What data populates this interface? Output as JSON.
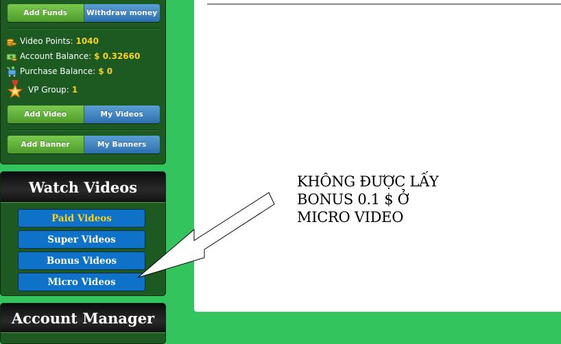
{
  "account_panel": {
    "buttons": [
      {
        "add": "Add Funds",
        "other": "Withdraw money"
      },
      {
        "add": "Add Video",
        "other": "My Videos"
      },
      {
        "add": "Add Banner",
        "other": "My Banners"
      }
    ],
    "stats": {
      "video_points": {
        "label": "Video Points:",
        "value": "1040",
        "icon": "coins-icon"
      },
      "account_balance": {
        "label": "Account Balance:",
        "value": "$ 0.32660",
        "icon": "money-icon"
      },
      "purchase_balance": {
        "label": "Purchase Balance:",
        "value": "$ 0",
        "icon": "cart-icon"
      },
      "vp_group": {
        "label": "VP Group:",
        "value": "1",
        "icon": "star-badge-icon"
      }
    }
  },
  "watch_videos": {
    "title": "Watch Videos",
    "items": [
      {
        "label": "Paid Videos",
        "active": true
      },
      {
        "label": "Super Videos",
        "active": false
      },
      {
        "label": "Bonus Videos",
        "active": false
      },
      {
        "label": "Micro Videos",
        "active": false
      }
    ]
  },
  "account_manager": {
    "title": "Account Manager"
  },
  "annotation": {
    "text": "KHÔNG ĐƯỢC LẤY\nBONUS 0.1 $  Ở\nMICRO VIDEO"
  },
  "colors": {
    "page_bg": "#33c45d",
    "panel_bg": "#1c5a22",
    "value_yellow": "#f7d21e",
    "button_blue": "#0d72c8"
  }
}
